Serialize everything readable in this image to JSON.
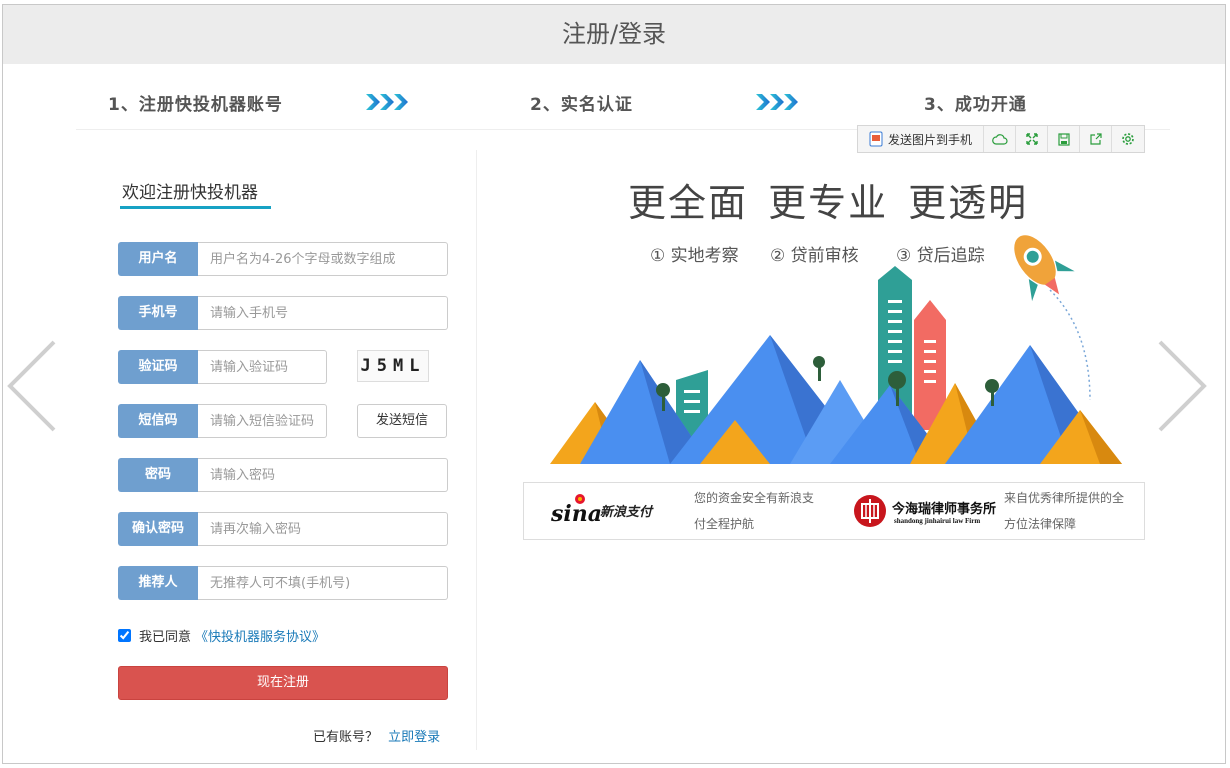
{
  "header": {
    "title": "注册/登录"
  },
  "steps": [
    {
      "label": "1、注册快投机器账号"
    },
    {
      "label": "2、实名认证"
    },
    {
      "label": "3、成功开通"
    }
  ],
  "toolbar": {
    "send_label": "发送图片到手机",
    "buttons": [
      "cloud-icon",
      "expand-icon",
      "save-icon",
      "share-icon",
      "settings-icon"
    ]
  },
  "form": {
    "title": "欢迎注册快投机器",
    "fields": [
      {
        "label": "用户名",
        "placeholder": "用户名为4-26个字母或数字组成"
      },
      {
        "label": "手机号",
        "placeholder": "请输入手机号"
      },
      {
        "label": "验证码",
        "placeholder": "请输入验证码"
      },
      {
        "label": "短信码",
        "placeholder": "请输入短信验证码"
      },
      {
        "label": "密码",
        "placeholder": "请输入密码"
      },
      {
        "label": "确认密码",
        "placeholder": "请再次输入密码"
      },
      {
        "label": "推荐人",
        "placeholder": "无推荐人可不填(手机号)"
      }
    ],
    "captcha_text": "J5ML",
    "sms_button": "发送短信",
    "agree_text": "我已同意",
    "agree_link": "《快投机器服务协议》",
    "agree_checked": true,
    "submit_label": "现在注册",
    "login_hint": "已有账号？",
    "login_link": "立即登录"
  },
  "promo": {
    "slogan": "更全面 更专业 更透明",
    "bullets": [
      "① 实地考察",
      "② 贷前审核",
      "③ 贷后追踪"
    ]
  },
  "partners": {
    "sina_logo": "sina",
    "sina_cn": "新浪支付",
    "sina_text": [
      "您的资金安全有新浪支",
      "付全程护航"
    ],
    "law_name": "今海瑞律师事务所",
    "law_en": "shandong jinhairui law Firm",
    "law_text": [
      "来自优秀律所提供的全",
      "方位法律保障"
    ]
  },
  "colors": {
    "accent": "#17a2c4",
    "label_bg": "#6f9fcf",
    "submit": "#d9534f",
    "link": "#1a7ab8"
  }
}
